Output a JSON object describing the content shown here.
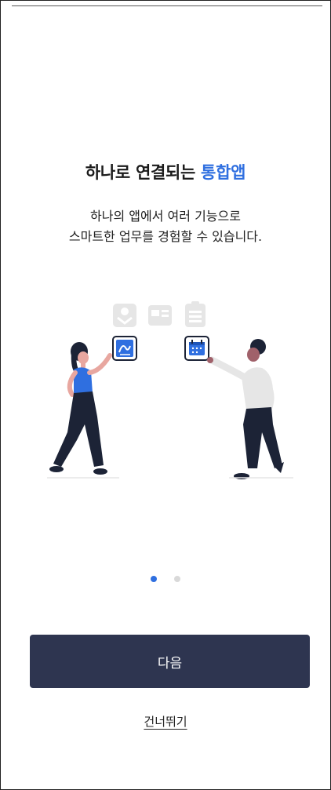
{
  "onboarding": {
    "title_prefix": "하나로 연결되는 ",
    "title_highlight": "통합앱",
    "subtitle_line1": "하나의 앱에서 여러 기능으로",
    "subtitle_line2": "스마트한 업무를 경험할 수 있습니다.",
    "page_indicator": {
      "current": 1,
      "total": 2
    },
    "next_label": "다음",
    "skip_label": "건너뛰기"
  },
  "illustration": {
    "icons": [
      "mail-icon",
      "id-card-icon",
      "clipboard-icon",
      "signature-icon",
      "calendar-icon"
    ]
  },
  "colors": {
    "accent": "#2f6fe0",
    "button_bg": "#2e3550",
    "dot_inactive": "#d9d9d9",
    "illustration_dark": "#1c2336"
  }
}
